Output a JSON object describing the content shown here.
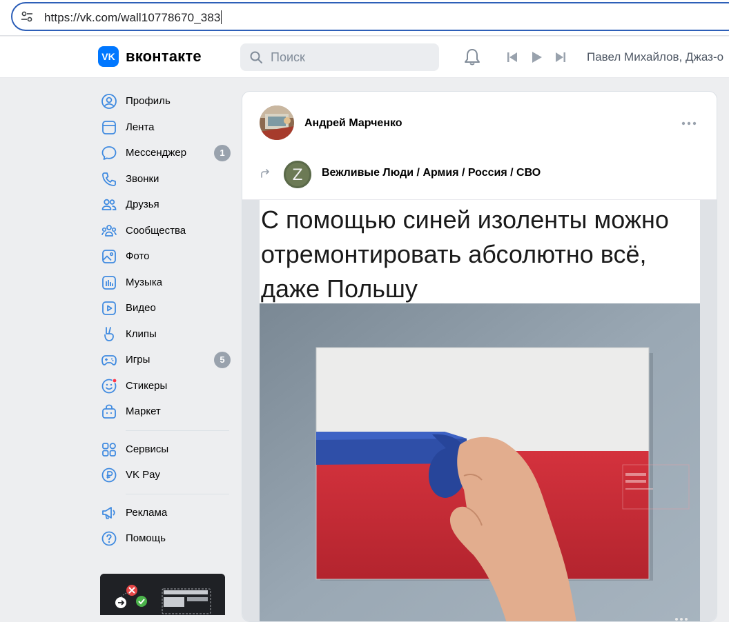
{
  "browser": {
    "url": "https://vk.com/wall10778670_383"
  },
  "header": {
    "logo": "VK",
    "brand": "вконтакте",
    "search_placeholder": "Поиск",
    "player_track": "Павел Михайлов, Джаз-о"
  },
  "sidebar": {
    "items": [
      {
        "label": "Профиль",
        "icon": "user-circle-icon"
      },
      {
        "label": "Лента",
        "icon": "newsfeed-icon"
      },
      {
        "label": "Мессенджер",
        "icon": "message-icon",
        "badge": "1"
      },
      {
        "label": "Звонки",
        "icon": "phone-icon"
      },
      {
        "label": "Друзья",
        "icon": "friends-icon"
      },
      {
        "label": "Сообщества",
        "icon": "communities-icon"
      },
      {
        "label": "Фото",
        "icon": "photo-icon"
      },
      {
        "label": "Музыка",
        "icon": "music-icon"
      },
      {
        "label": "Видео",
        "icon": "video-icon"
      },
      {
        "label": "Клипы",
        "icon": "clips-icon"
      },
      {
        "label": "Игры",
        "icon": "gamepad-icon",
        "badge": "5"
      },
      {
        "label": "Стикеры",
        "icon": "sticker-icon"
      },
      {
        "label": "Маркет",
        "icon": "market-bag-icon"
      }
    ],
    "items2": [
      {
        "label": "Сервисы",
        "icon": "services-grid-icon"
      },
      {
        "label": "VK Pay",
        "icon": "vkpay-icon"
      }
    ],
    "items3": [
      {
        "label": "Реклама",
        "icon": "megaphone-icon"
      },
      {
        "label": "Помощь",
        "icon": "help-icon"
      }
    ]
  },
  "post": {
    "author": "Андрей Марченко",
    "source_group": "Вежливые Люди / Армия / Россия / СВО",
    "group_avatar_letter": "Z",
    "meme_caption": "С помощью синей изоленты можно отремонтировать абсолютно всё, даже Польшу"
  },
  "colors": {
    "accent": "#0077ff",
    "badge": "#99a2ad",
    "background": "#edeef0"
  }
}
